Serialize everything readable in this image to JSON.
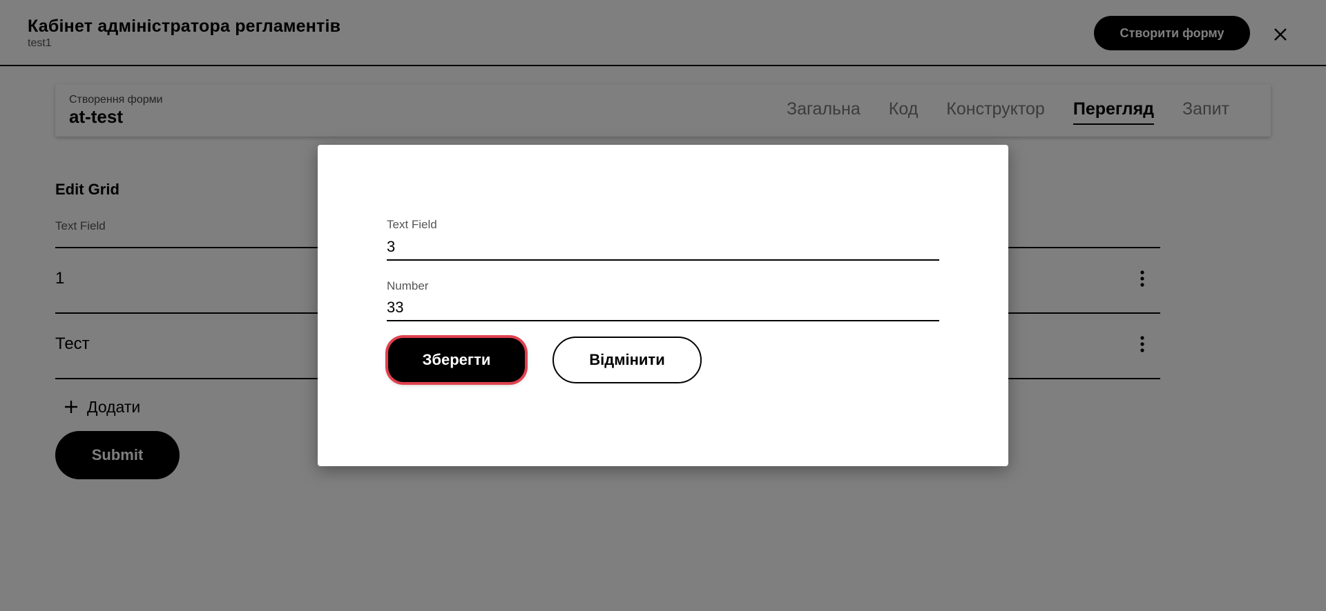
{
  "header": {
    "title": "Кабінет адміністратора регламентів",
    "subtitle": "test1",
    "create_form_label": "Створити форму"
  },
  "form_card": {
    "caption": "Створення форми",
    "name": "at-test",
    "tabs": [
      {
        "label": "Загальна",
        "active": false
      },
      {
        "label": "Код",
        "active": false
      },
      {
        "label": "Конструктор",
        "active": false
      },
      {
        "label": "Перегляд",
        "active": true
      },
      {
        "label": "Запит",
        "active": false
      }
    ]
  },
  "preview": {
    "grid_title": "Edit Grid",
    "column_header": "Text Field",
    "rows": [
      {
        "value": "1"
      },
      {
        "value": "Тест"
      }
    ],
    "add_label": "Додати",
    "submit_label": "Submit"
  },
  "modal": {
    "fields": [
      {
        "label": "Text Field",
        "value": "3"
      },
      {
        "label": "Number",
        "value": "33"
      }
    ],
    "save_label": "Зберегти",
    "cancel_label": "Відмінити"
  },
  "icons": {
    "close": "close-icon",
    "row_menu": "kebab-menu-icon",
    "add": "plus-icon"
  },
  "colors": {
    "overlay": "#000000",
    "focus_ring": "#e0414e",
    "primary": "#000000"
  }
}
